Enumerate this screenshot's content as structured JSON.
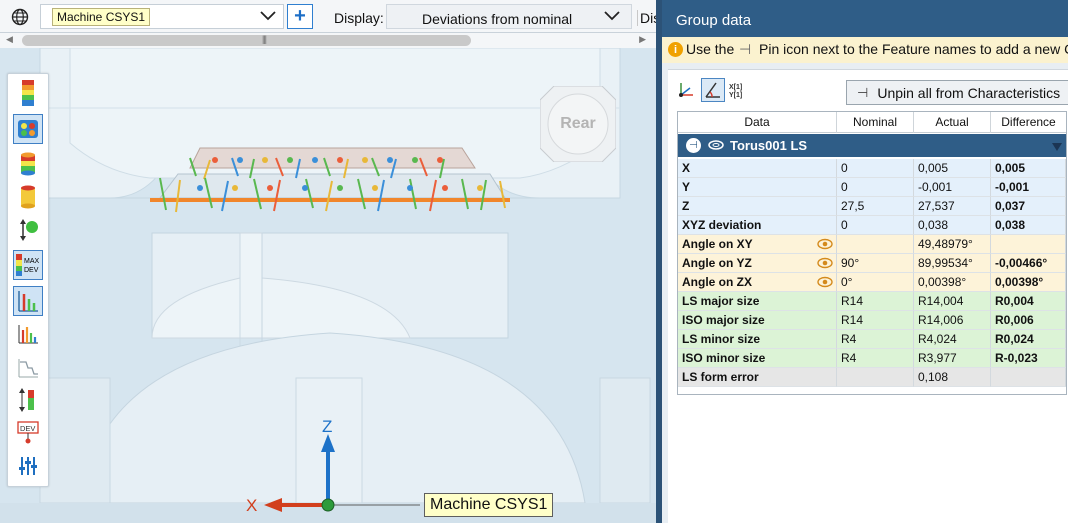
{
  "toolbar": {
    "coordinate_system": "Machine CSYS1",
    "add_button": "+",
    "display_label": "Display:",
    "display_value": "Deviations from nominal",
    "truncated_label": "Dis"
  },
  "viewport": {
    "view_cube_label": "Rear",
    "axis_z": "Z",
    "axis_x": "X",
    "csys_tag": "Machine CSYS1",
    "side_tool_badges": {
      "max_dev": "MAX\nDEV",
      "dev": "DEV"
    }
  },
  "panel": {
    "title": "Group data",
    "hint_part1": "Use the",
    "hint_part2": "Pin icon next to the Feature names to add a new C",
    "unpin_label": "Unpin all from Characteristics",
    "columns": [
      "Data",
      "Nominal",
      "Actual",
      "Difference"
    ],
    "feature_name": "Torus001  LS",
    "rows": [
      {
        "name": "X",
        "nominal": "0",
        "actual": "0,005",
        "difference": "0,005",
        "eye": false
      },
      {
        "name": "Y",
        "nominal": "0",
        "actual": "-0,001",
        "difference": "-0,001",
        "eye": false
      },
      {
        "name": "Z",
        "nominal": "27,5",
        "actual": "27,537",
        "difference": "0,037",
        "eye": false
      },
      {
        "name": "XYZ deviation",
        "nominal": "0",
        "actual": "0,038",
        "difference": "0,038",
        "eye": false
      },
      {
        "name": "Angle on XY",
        "nominal": "",
        "actual": "49,48979°",
        "difference": "",
        "eye": true
      },
      {
        "name": "Angle on YZ",
        "nominal": "90°",
        "actual": "89,99534°",
        "difference": "-0,00466°",
        "eye": true
      },
      {
        "name": "Angle on ZX",
        "nominal": "0°",
        "actual": "0,00398°",
        "difference": "0,00398°",
        "eye": true
      },
      {
        "name": "LS major size",
        "nominal": "R14",
        "actual": "R14,004",
        "difference": "R0,004",
        "eye": false
      },
      {
        "name": "ISO major size",
        "nominal": "R14",
        "actual": "R14,006",
        "difference": "R0,006",
        "eye": false
      },
      {
        "name": "LS minor size",
        "nominal": "R4",
        "actual": "R4,024",
        "difference": "R0,024",
        "eye": false
      },
      {
        "name": "ISO minor size",
        "nominal": "R4",
        "actual": "R3,977",
        "difference": "R-0,023",
        "eye": false
      },
      {
        "name": "LS form error",
        "nominal": "",
        "actual": "0,108",
        "difference": "",
        "eye": false
      }
    ],
    "row_colors": [
      "#e4f0fb",
      "#e4f0fb",
      "#e4f0fb",
      "#e4f0fb",
      "#fdf3d9",
      "#fdf3d9",
      "#fdf3d9",
      "#dcf3d6",
      "#dcf3d6",
      "#dcf3d6",
      "#dcf3d6",
      "#e6e6e6"
    ]
  }
}
